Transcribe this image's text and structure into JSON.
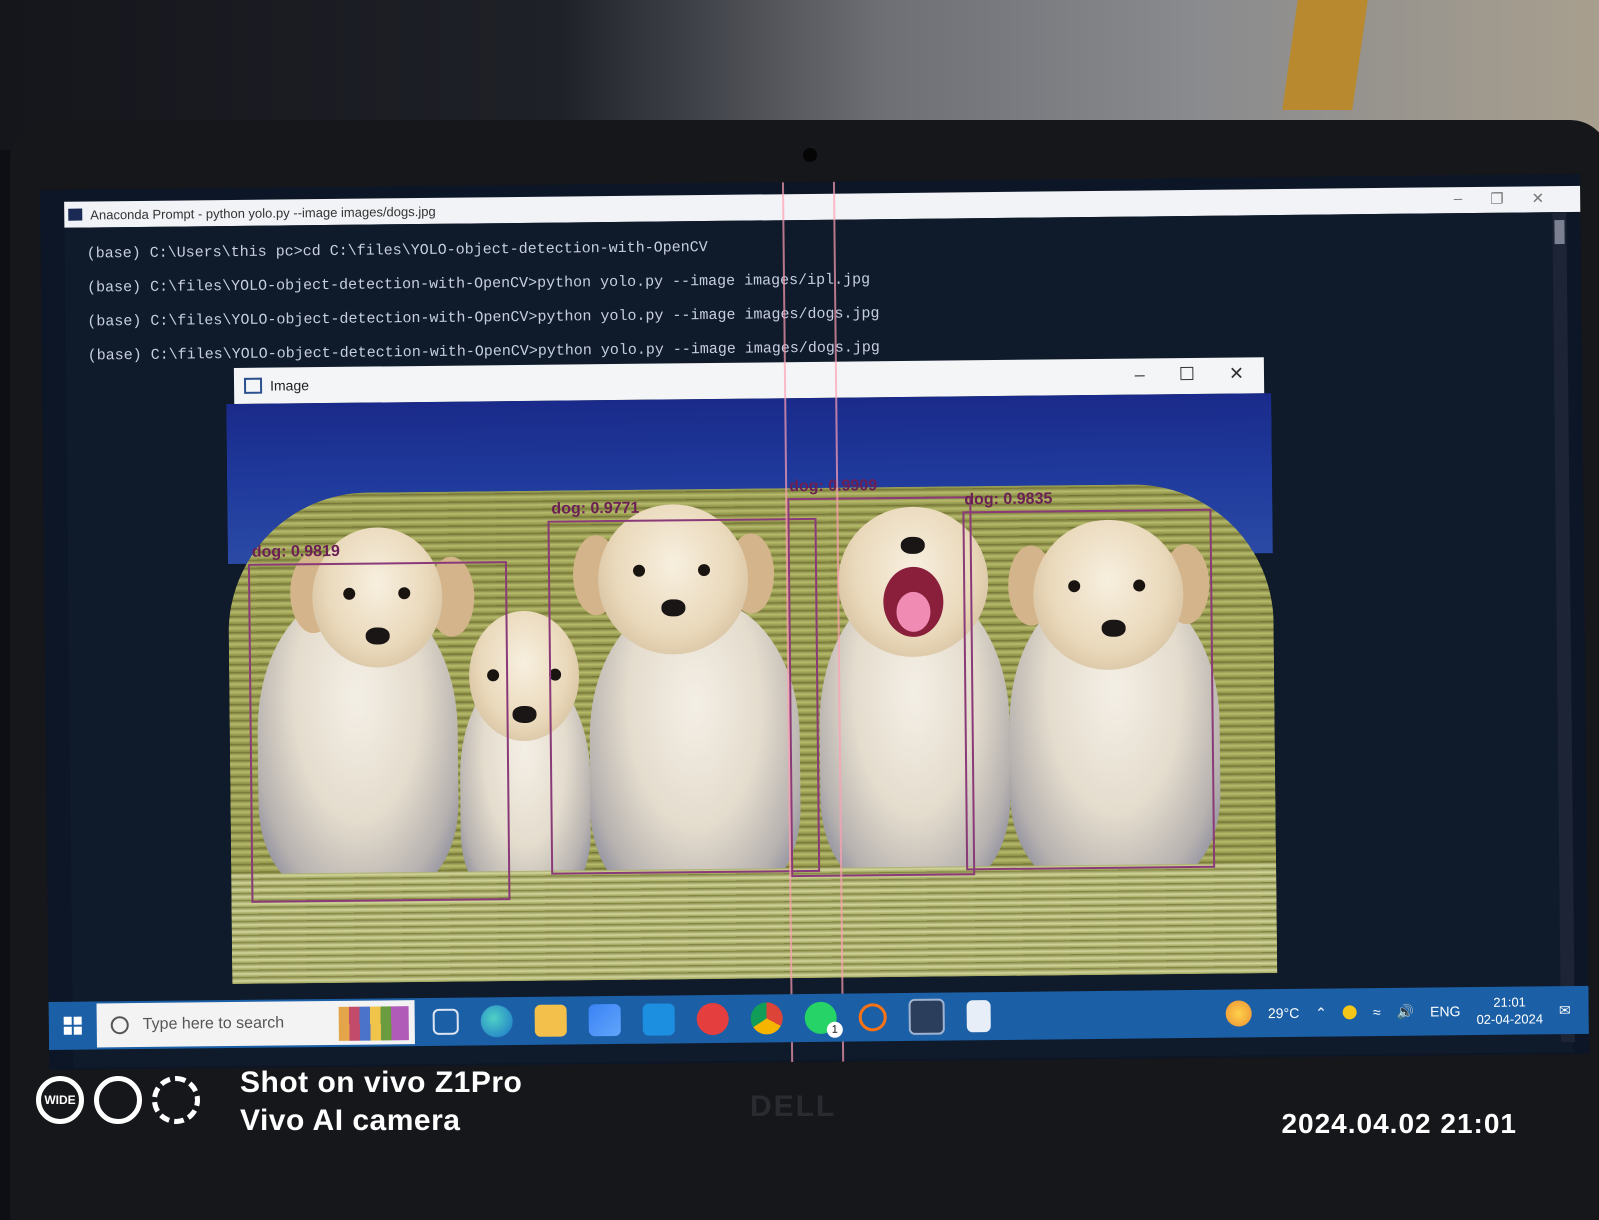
{
  "console": {
    "title": "Anaconda Prompt - python  yolo.py --image images/dogs.jpg",
    "lines": [
      "(base) C:\\Users\\this pc>cd C:\\files\\YOLO-object-detection-with-OpenCV",
      "(base) C:\\files\\YOLO-object-detection-with-OpenCV>python yolo.py --image images/ipl.jpg",
      "(base) C:\\files\\YOLO-object-detection-with-OpenCV>python yolo.py --image images/dogs.jpg",
      "(base) C:\\files\\YOLO-object-detection-with-OpenCV>python yolo.py --image images/dogs.jpg"
    ]
  },
  "image_window": {
    "title": "Image",
    "detections": [
      {
        "label": "dog: 0.9819"
      },
      {
        "label": "dog: 0.9771"
      },
      {
        "label": "dog: 0.9909"
      },
      {
        "label": "dog: 0.9835"
      }
    ]
  },
  "taskbar": {
    "search_placeholder": "Type here to search",
    "weather": "29°C",
    "lang": "ENG",
    "time": "21:01",
    "date": "02-04-2024",
    "whatsapp_badge": "1"
  },
  "watermark": {
    "line1": "Shot on vivo Z1Pro",
    "line2": "Vivo AI camera",
    "datetime": "2024.04.02 21:01",
    "wide_label": "WIDE"
  },
  "brand": "DELL",
  "colors": {
    "bbox": "#8a3a78",
    "taskbar": "#1b5fa6"
  }
}
